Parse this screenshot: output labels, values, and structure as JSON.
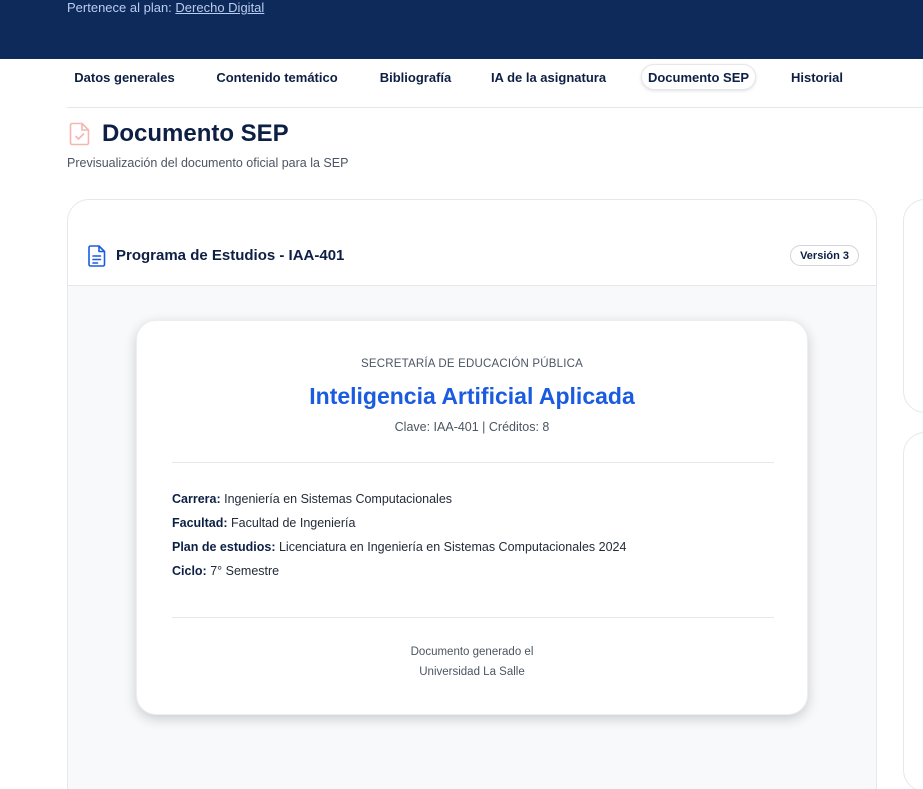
{
  "header": {
    "plan_prefix": "Pertenece al plan:",
    "plan_name": "Derecho Digital"
  },
  "tabs": [
    {
      "label": "Datos generales"
    },
    {
      "label": "Contenido temático"
    },
    {
      "label": "Bibliografía"
    },
    {
      "label": "IA de la asignatura"
    },
    {
      "label": "Documento SEP",
      "active": true
    },
    {
      "label": "Historial"
    }
  ],
  "page": {
    "title": "Documento SEP",
    "subtitle": "Previsualización del documento oficial para la SEP"
  },
  "card": {
    "title": "Programa de Estudios - IAA-401",
    "version": "Versión 3"
  },
  "document": {
    "institution": "SECRETARÍA DE EDUCACIÓN PÚBLICA",
    "course_name": "Inteligencia Artificial Aplicada",
    "clave_line": "Clave: IAA-401 | Créditos: 8",
    "fields": [
      {
        "label": "Carrera:",
        "value": "Ingeniería en Sistemas Computacionales"
      },
      {
        "label": "Facultad:",
        "value": "Facultad de Ingeniería"
      },
      {
        "label": "Plan de estudios:",
        "value": "Licenciatura en Ingeniería en Sistemas Computacionales 2024"
      },
      {
        "label": "Ciclo:",
        "value": "7° Semestre"
      }
    ],
    "footer_generated": "Documento generado el",
    "footer_university": "Universidad La Salle"
  },
  "colors": {
    "topbar": "#0d2a5a",
    "accent": "#1a5be0",
    "page_icon": "#f3b6b0"
  },
  "icons": {
    "page_icon": "document-check-icon",
    "card_icon": "document-text-icon"
  }
}
